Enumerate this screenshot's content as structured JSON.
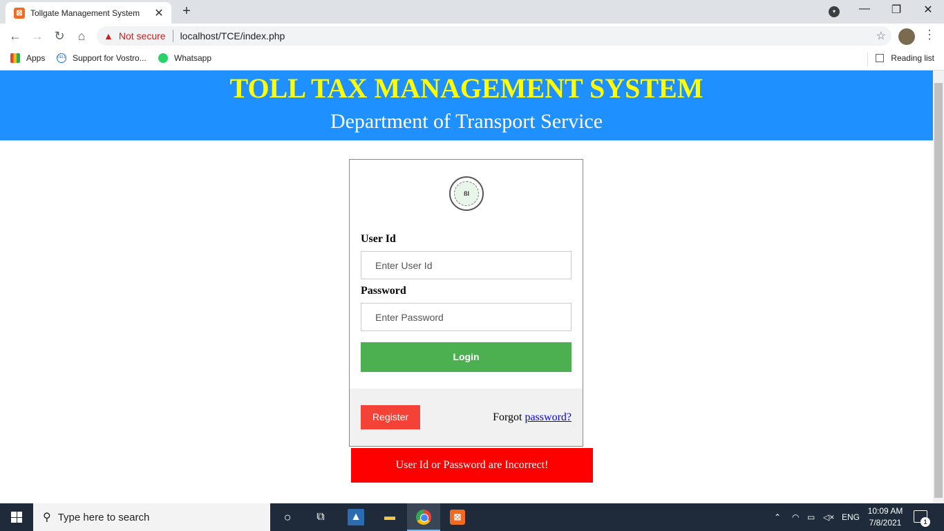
{
  "browser": {
    "tab_title": "Tollgate Management System",
    "tab_close": "✕",
    "new_tab": "+",
    "window_controls": {
      "minimize": "—",
      "restore": "❐",
      "close": "✕"
    },
    "security_label": "Not secure",
    "url": "localhost/TCE/index.php",
    "bookmarks": [
      {
        "label": "Apps",
        "icon": "apps-grid-icon"
      },
      {
        "label": "Support for Vostro...",
        "icon": "dell-icon"
      },
      {
        "label": "Whatsapp",
        "icon": "whatsapp-icon"
      }
    ],
    "reading_list": "Reading list"
  },
  "header": {
    "title": "TOLL TAX MANAGEMENT SYSTEM",
    "subtitle": "Department of Transport Service",
    "bg_color": "#1e90ff",
    "title_color": "#ffff00"
  },
  "login": {
    "user_label": "User Id",
    "user_placeholder": "Enter User Id",
    "password_label": "Password",
    "password_placeholder": "Enter Password",
    "login_button": "Login",
    "register_button": "Register",
    "forgot_text": "Forgot",
    "forgot_link": "password?",
    "login_color": "#4caf50",
    "register_color": "#f44336"
  },
  "error": {
    "message": "User Id or Password are Incorrect!",
    "color": "#ff0000"
  },
  "taskbar": {
    "search_placeholder": "Type here to search",
    "language": "ENG",
    "time": "10:09 AM",
    "date": "7/8/2021",
    "notification_count": "1"
  }
}
